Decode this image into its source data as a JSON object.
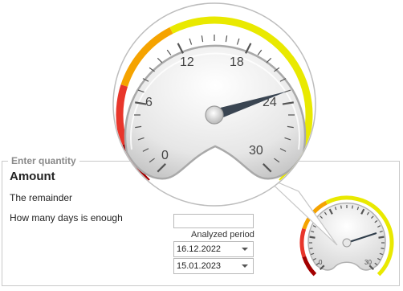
{
  "form": {
    "group_title": "Enter quantity",
    "amount_title": "Amount",
    "remainder_label": "The remainder",
    "days_label": "How many days is enough",
    "analyzed_period_label": "Analyzed period",
    "date_from": "16.12.2022",
    "date_to": "15.01.2023"
  },
  "gauge": {
    "tick_labels": [
      "0",
      "6",
      "12",
      "18",
      "24",
      "30"
    ],
    "small_tick_labels": [
      "0",
      "30"
    ],
    "min": 0,
    "max": 30,
    "needle_value": 23,
    "colors": {
      "danger": "#a30000",
      "warning": "#e8362b",
      "caution": "#f5a300",
      "ok": "#e9e900"
    }
  }
}
